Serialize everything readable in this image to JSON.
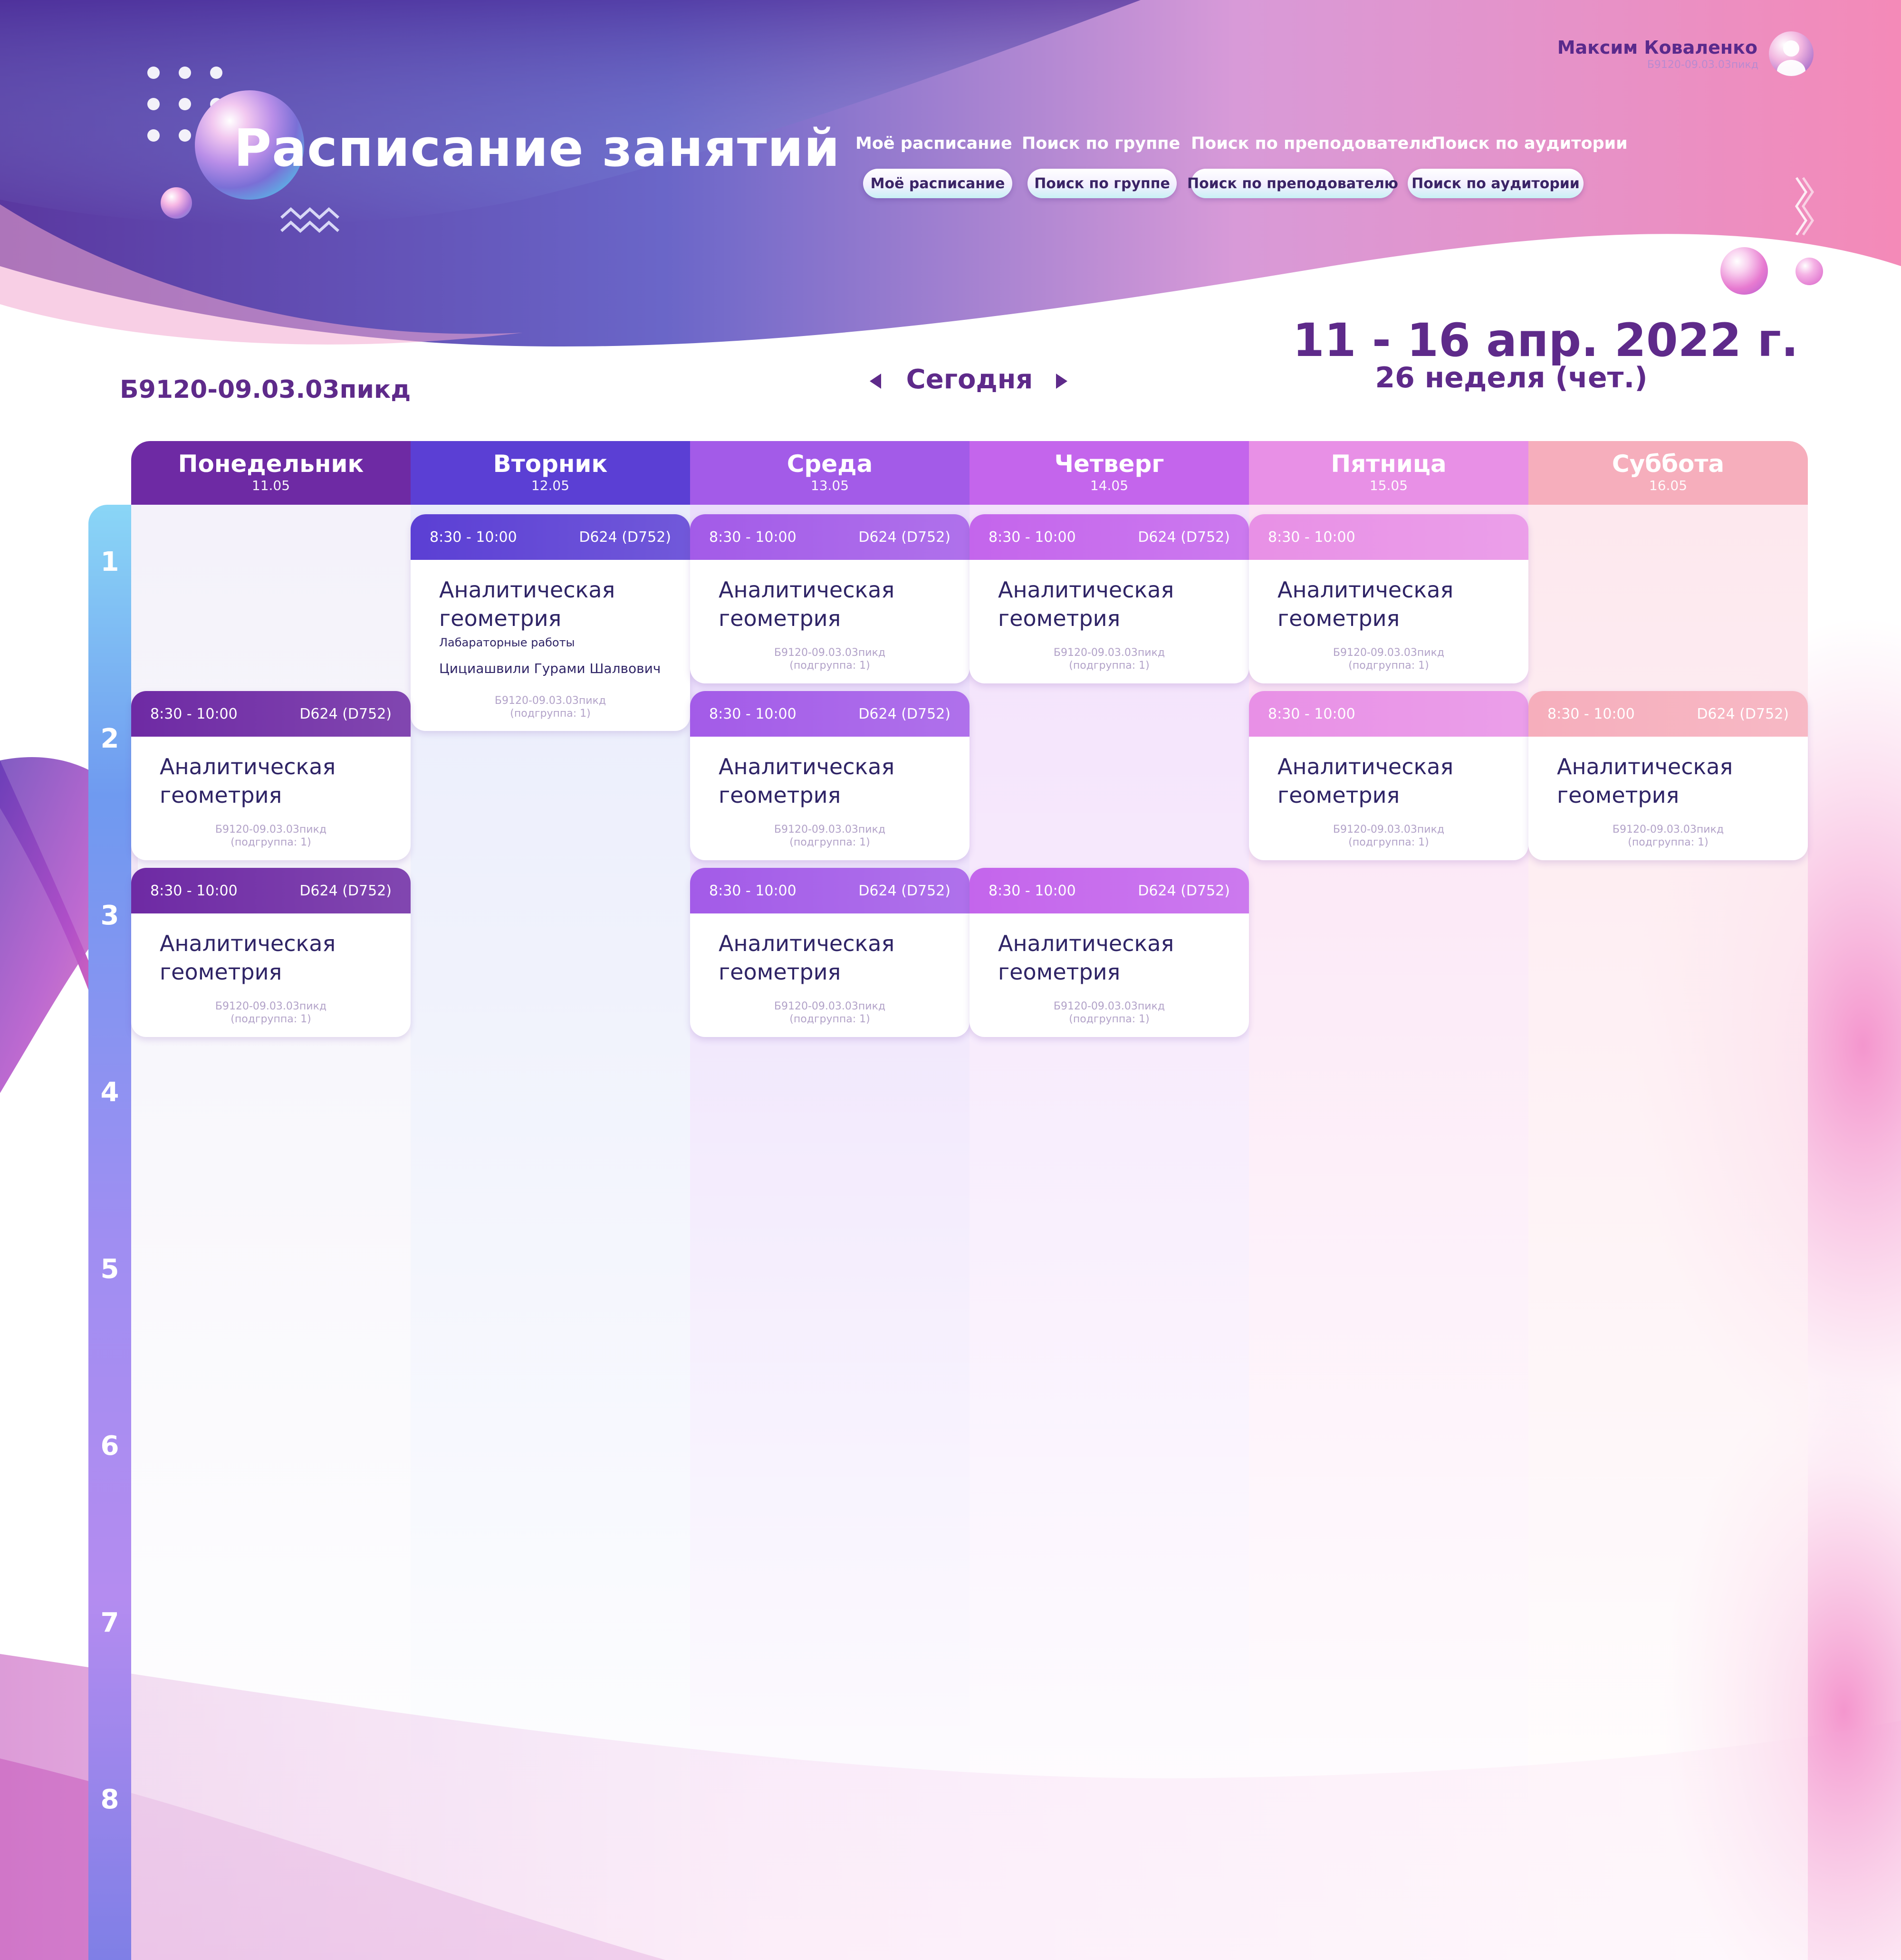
{
  "header": {
    "title": "Расписание занятий",
    "user": {
      "name": "Максим Коваленко",
      "group": "Б9120-09.03.03пикд"
    },
    "nav_links": [
      "Моё расписание",
      "Поиск по группе",
      "Поиск по преподователю",
      "Поиск по аудитории"
    ],
    "nav_buttons": [
      "Моё расписание",
      "Поиск по группе",
      "Поиск по преподователю",
      "Поиск по аудитории"
    ]
  },
  "subheader": {
    "group": "Б9120-09.03.03пикд",
    "today": "Сегодня",
    "date_range": "11 - 16 апр. 2022 г.",
    "week": "26 неделя (чет.)"
  },
  "days": [
    {
      "name": "Понедельник",
      "date": "11.05"
    },
    {
      "name": "Вторник",
      "date": "12.05"
    },
    {
      "name": "Среда",
      "date": "13.05"
    },
    {
      "name": "Четверг",
      "date": "14.05"
    },
    {
      "name": "Пятница",
      "date": "15.05"
    },
    {
      "name": "Суббота",
      "date": "16.05"
    }
  ],
  "slots": [
    "1",
    "2",
    "3",
    "4",
    "5",
    "6",
    "7",
    "8"
  ],
  "cards": [
    {
      "day": 1,
      "slot": 1,
      "time": "8:30 - 10:00",
      "room": "D624 (D752)",
      "subject_line1": "Аналитическая",
      "subject_line2": "геометрия",
      "type": "Лабараторные работы",
      "teacher": "Цициашвили Гурами Шалвович",
      "group": "Б9120-09.03.03пикд",
      "subgroup": "(подгруппа: 1)"
    },
    {
      "day": 2,
      "slot": 1,
      "time": "8:30 - 10:00",
      "room": "D624 (D752)",
      "subject_line1": "Аналитическая",
      "subject_line2": "геометрия",
      "group": "Б9120-09.03.03пикд",
      "subgroup": "(подгруппа: 1)"
    },
    {
      "day": 3,
      "slot": 1,
      "time": "8:30 - 10:00",
      "room": "D624 (D752)",
      "subject_line1": "Аналитическая",
      "subject_line2": "геометрия",
      "group": "Б9120-09.03.03пикд",
      "subgroup": "(подгруппа: 1)"
    },
    {
      "day": 4,
      "slot": 1,
      "time": "8:30 - 10:00",
      "room": "",
      "subject_line1": "Аналитическая",
      "subject_line2": "геометрия",
      "group": "Б9120-09.03.03пикд",
      "subgroup": "(подгруппа: 1)"
    },
    {
      "day": 0,
      "slot": 2,
      "time": "8:30 - 10:00",
      "room": "D624 (D752)",
      "subject_line1": "Аналитическая",
      "subject_line2": "геометрия",
      "group": "Б9120-09.03.03пикд",
      "subgroup": "(подгруппа: 1)"
    },
    {
      "day": 2,
      "slot": 2,
      "time": "8:30 - 10:00",
      "room": "D624 (D752)",
      "subject_line1": "Аналитическая",
      "subject_line2": "геометрия",
      "group": "Б9120-09.03.03пикд",
      "subgroup": "(подгруппа: 1)"
    },
    {
      "day": 4,
      "slot": 2,
      "time": "8:30 - 10:00",
      "room": "",
      "subject_line1": "Аналитическая",
      "subject_line2": "геометрия",
      "group": "Б9120-09.03.03пикд",
      "subgroup": "(подгруппа: 1)"
    },
    {
      "day": 5,
      "slot": 2,
      "time": "8:30 - 10:00",
      "room": "D624 (D752)",
      "subject_line1": "Аналитическая",
      "subject_line2": "геометрия",
      "group": "Б9120-09.03.03пикд",
      "subgroup": "(подгруппа: 1)"
    },
    {
      "day": 0,
      "slot": 3,
      "time": "8:30 - 10:00",
      "room": "D624 (D752)",
      "subject_line1": "Аналитическая",
      "subject_line2": "геометрия",
      "group": "Б9120-09.03.03пикд",
      "subgroup": "(подгруппа: 1)"
    },
    {
      "day": 2,
      "slot": 3,
      "time": "8:30 - 10:00",
      "room": "D624 (D752)",
      "subject_line1": "Аналитическая",
      "subject_line2": "геометрия",
      "group": "Б9120-09.03.03пикд",
      "subgroup": "(подгруппа: 1)"
    },
    {
      "day": 3,
      "slot": 3,
      "time": "8:30 - 10:00",
      "room": "D624 (D752)",
      "subject_line1": "Аналитическая",
      "subject_line2": "геометрия",
      "group": "Б9120-09.03.03пикд",
      "subgroup": "(подгруппа: 1)"
    }
  ],
  "colors": {
    "day_headers": [
      "#6e2aa4",
      "#5b3fd4",
      "#a35be8",
      "#c465ec",
      "#e890e6",
      "#f6aebc"
    ],
    "day_columns": [
      "#f4f2fa",
      "#e9ecfb",
      "#eadcfb",
      "#f3e1fb",
      "#fbe2f4",
      "#fde8ee"
    ],
    "title": "#5e2a8a",
    "card_text": "#2f2466"
  }
}
